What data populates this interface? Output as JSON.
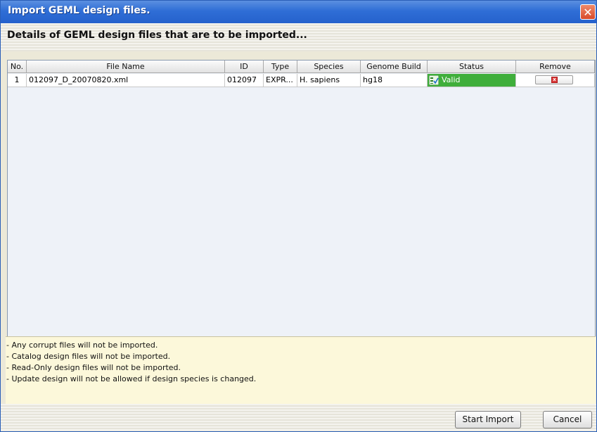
{
  "window": {
    "title": "Import GEML design files.",
    "close_symbol": "✕"
  },
  "heading": "Details of GEML design files that are to be imported...",
  "table": {
    "columns": [
      "No.",
      "File Name",
      "ID",
      "Type",
      "Species",
      "Genome Build",
      "Status",
      "Remove"
    ],
    "rows": [
      {
        "no": "1",
        "file_name": "012097_D_20070820.xml",
        "id": "012097",
        "type": "EXPR...",
        "species": "H. sapiens",
        "genome_build": "hg18",
        "status": "Valid"
      }
    ]
  },
  "notes": [
    "- Any corrupt files will not be imported.",
    "- Catalog design files will not be imported.",
    "- Read-Only design files will not be imported.",
    "- Update design will not be allowed if design species is changed."
  ],
  "buttons": {
    "start_import": "Start Import",
    "cancel": "Cancel"
  },
  "colors": {
    "titlebar": "#2f6ed6",
    "status_valid": "#3fae3b",
    "notes_bg": "#fcf8da"
  },
  "icons": {
    "close": "close-icon",
    "status": "valid-status-icon",
    "remove": "remove-icon"
  }
}
